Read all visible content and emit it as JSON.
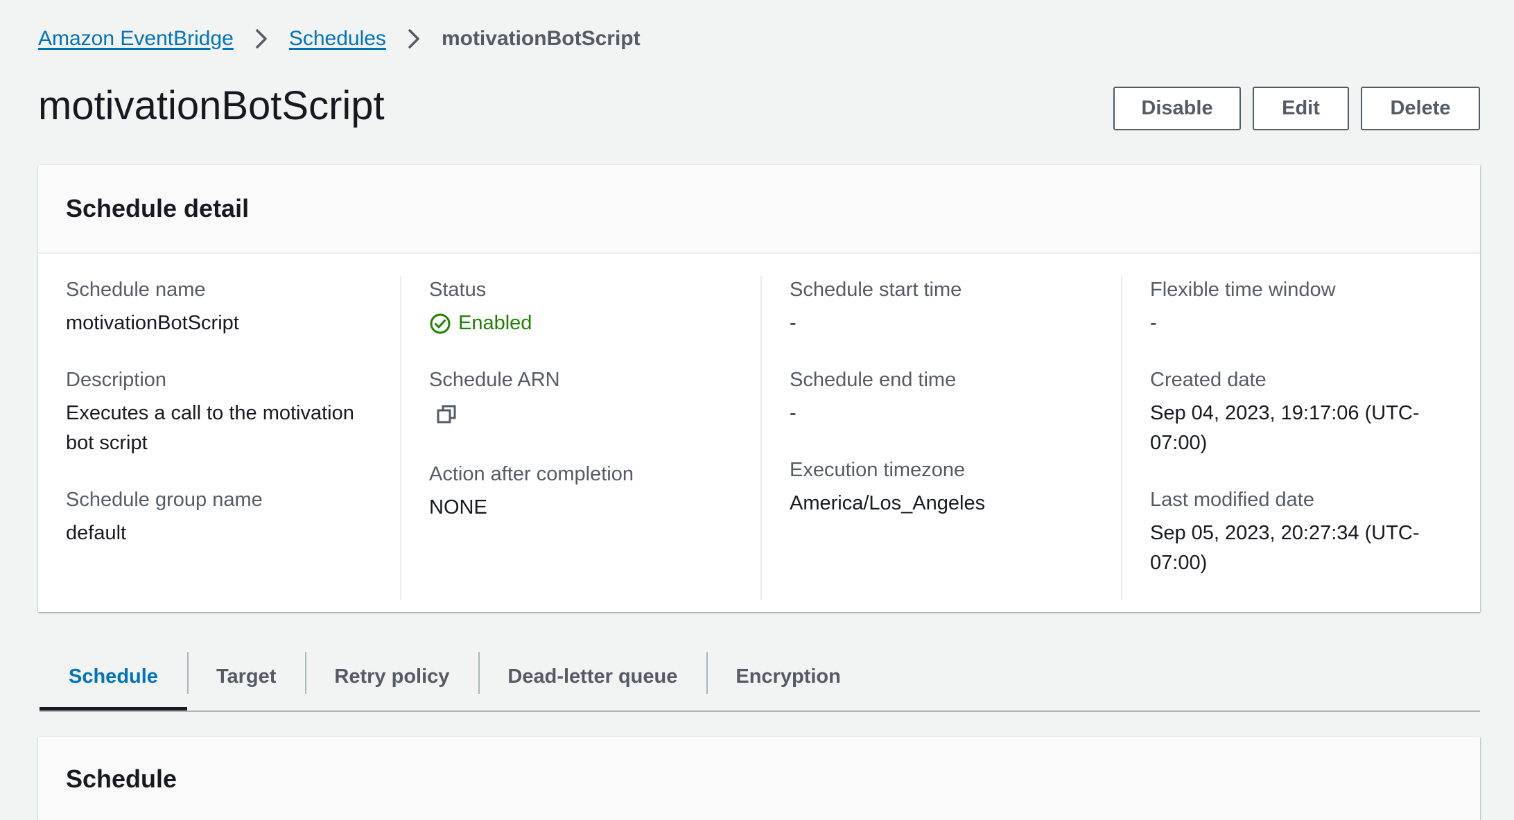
{
  "breadcrumb": {
    "items": [
      "Amazon EventBridge",
      "Schedules"
    ],
    "current": "motivationBotScript"
  },
  "header": {
    "title": "motivationBotScript",
    "actions": {
      "disable": "Disable",
      "edit": "Edit",
      "delete": "Delete"
    }
  },
  "detail": {
    "title": "Schedule detail",
    "col1": {
      "schedule_name_label": "Schedule name",
      "schedule_name": "motivationBotScript",
      "description_label": "Description",
      "description": "Executes a call to the motivation bot script",
      "group_label": "Schedule group name",
      "group": "default"
    },
    "col2": {
      "status_label": "Status",
      "status": "Enabled",
      "status_icon": "check-circle-icon",
      "arn_label": "Schedule ARN",
      "arn_icon": "copy-icon",
      "action_label": "Action after completion",
      "action": "NONE"
    },
    "col3": {
      "start_label": "Schedule start time",
      "start": "-",
      "end_label": "Schedule end time",
      "end": "-",
      "timezone_label": "Execution timezone",
      "timezone": "America/Los_Angeles"
    },
    "col4": {
      "flex_label": "Flexible time window",
      "flex": "-",
      "created_label": "Created date",
      "created": "Sep 04, 2023, 19:17:06 (UTC-07:00)",
      "modified_label": "Last modified date",
      "modified": "Sep 05, 2023, 20:27:34 (UTC-07:00)"
    }
  },
  "tabs": [
    "Schedule",
    "Target",
    "Retry policy",
    "Dead-letter queue",
    "Encryption"
  ],
  "active_tab": "Schedule",
  "section": {
    "title": "Schedule"
  },
  "colors": {
    "link": "#0073bb",
    "success": "#1d8102",
    "background": "#f2f3f3"
  }
}
